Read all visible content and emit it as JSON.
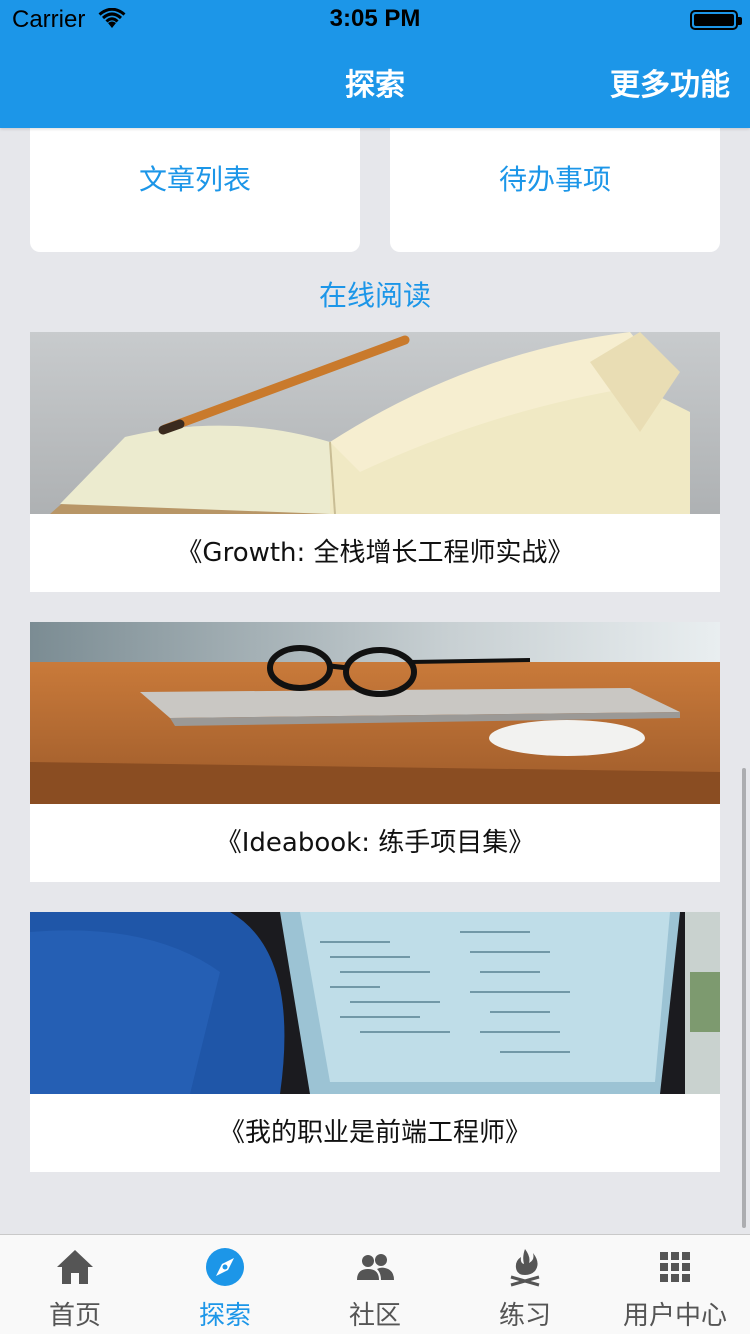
{
  "status_bar": {
    "carrier": "Carrier",
    "time": "3:05 PM"
  },
  "nav": {
    "title": "探索",
    "right_action": "更多功能"
  },
  "tiles": [
    {
      "label": "文章列表",
      "icon": "article-list-icon"
    },
    {
      "label": "待办事项",
      "icon": "todo-icon"
    }
  ],
  "section": {
    "title": "在线阅读"
  },
  "books": [
    {
      "title": "《Growth: 全栈增长工程师实战》",
      "image": "open-notebook-pencil"
    },
    {
      "title": "《Ideabook: 练手项目集》",
      "image": "laptop-glasses-mouse"
    },
    {
      "title": "《我的职业是前端工程师》",
      "image": "code-on-laptop-screen"
    }
  ],
  "tabbar": {
    "items": [
      {
        "label": "首页",
        "icon": "home-icon",
        "active": false
      },
      {
        "label": "探索",
        "icon": "compass-icon",
        "active": true
      },
      {
        "label": "社区",
        "icon": "community-icon",
        "active": false
      },
      {
        "label": "练习",
        "icon": "practice-flame-icon",
        "active": false
      },
      {
        "label": "用户中心",
        "icon": "grid-icon",
        "active": false
      }
    ]
  },
  "colors": {
    "primary": "#1c96e8",
    "background": "#e6e7eb"
  }
}
